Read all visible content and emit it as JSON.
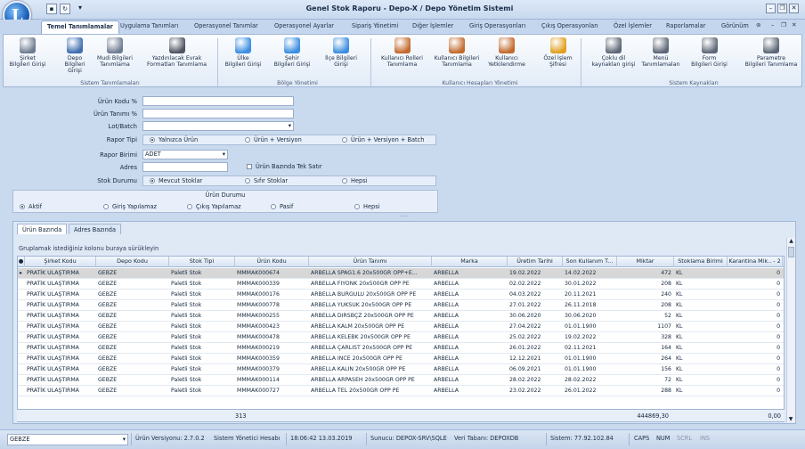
{
  "app": {
    "title": "Genel Stok Raporu  - Depo-X / Depo Yönetim Sistemi"
  },
  "window": {
    "min": "–",
    "restore": "❐",
    "close": "✕"
  },
  "menu_tabs": [
    "Temel Tanımlamalar",
    "Uygulama Tanımları",
    "Operasyonel Tanımlar",
    "Operasyonel Ayarlar",
    "Sipariş Yönetimi",
    "Diğer İşlemler",
    "Giriş Operasyonları",
    "Çıkış Operasyonları",
    "Özel İşlemler",
    "Raporlamalar",
    "Görünüm"
  ],
  "ribbon": {
    "buttons": [
      {
        "label1": "Şirket",
        "label2": "Bilgileri Girişi",
        "icon": "building-icon",
        "color": "#6f7d92"
      },
      {
        "label1": "Depo",
        "label2": "Bilgileri Girişi",
        "icon": "warehouse-icon",
        "color": "#3f6fb0"
      },
      {
        "label1": "Mudi Bilgileri",
        "label2": "Tanımlama",
        "icon": "building-icon",
        "color": "#6f7d92"
      },
      {
        "label1": "Yazdırılacak Evrak",
        "label2": "Formatları Tanımlama",
        "icon": "printer-icon",
        "color": "#4d5360"
      },
      {
        "label1": "Ülke",
        "label2": "Bilgileri Girişi",
        "icon": "globe-icon",
        "color": "#3b8ee0"
      },
      {
        "label1": "Şehir",
        "label2": "Bilgileri Girişi",
        "icon": "globe-icon",
        "color": "#3b8ee0"
      },
      {
        "label1": "İlçe Bilgileri",
        "label2": "Girişi",
        "icon": "globe-icon",
        "color": "#3b8ee0"
      },
      {
        "label1": "Kullanıcı Rolleri",
        "label2": "Tanımlama",
        "icon": "users-icon",
        "color": "#c36a2d"
      },
      {
        "label1": "Kullanıcı Bilgileri",
        "label2": "Tanımlama",
        "icon": "users-icon",
        "color": "#c36a2d"
      },
      {
        "label1": "Kullanıcı",
        "label2": "Yetkilendirme",
        "icon": "users-icon",
        "color": "#c36a2d"
      },
      {
        "label1": "Özel İşlem",
        "label2": "Şifresi",
        "icon": "lock-icon",
        "color": "#e0a020"
      },
      {
        "label1": "Çoklu dil",
        "label2": "kaynakları girişi",
        "icon": "tools-icon",
        "color": "#5e6877"
      },
      {
        "label1": "Menü",
        "label2": "Tanımlamaları",
        "icon": "tools-icon",
        "color": "#5e6877"
      },
      {
        "label1": "Form",
        "label2": "Bilgileri Girişi",
        "icon": "tools-icon",
        "color": "#5e6877"
      },
      {
        "label1": "Parametre",
        "label2": "Bilgileri Tanımlama",
        "icon": "tools-icon",
        "color": "#5e6877"
      }
    ],
    "groups": [
      "Sistem Tanımlamaları",
      "Bölge Yönetimi",
      "Kullanıcı Hesapları Yönetimi",
      "Sistem Kaynakları"
    ]
  },
  "filters": {
    "urun_kodu_label": "Ürün Kodu %",
    "urun_tanimi_label": "Ürün Tanımı %",
    "lot_label": "Lot/Batch",
    "rapor_tipi_label": "Rapor Tipi",
    "rapor_tipi_options": [
      "Yalnızca Ürün",
      "Ürün + Versiyon",
      "Ürün + Versiyon + Batch"
    ],
    "rapor_birimi_label": "Rapor Birimi",
    "rapor_birimi_value": "ADET",
    "tek_satir_label": "Ürün Bazında Tek Satır",
    "adres_label": "Adres",
    "stok_durumu_label": "Stok Durumu",
    "stok_options": [
      "Mevcut Stoklar",
      "Sıfır Stoklar",
      "Hepsi"
    ],
    "urun_durumu_title": "Ürün Durumu",
    "urun_durumu_options": [
      "Aktif",
      "Giriş Yapılamaz",
      "Çıkış Yapılamaz",
      "Pasif",
      "Hepsi"
    ]
  },
  "grid": {
    "tabs": [
      "Ürün Bazında",
      "Adres Bazında"
    ],
    "group_hint": "Gruplamak istediğiniz kolonu buraya sürükleyin",
    "columns": [
      "Şirket Kodu",
      "Depo Kodu",
      "Stok Tipi",
      "Ürün Kodu",
      "Ürün Tanımı",
      "Marka",
      "Üretim Tarihi",
      "Son Kullanım T...",
      "Miktar",
      "Stoklama Birimi",
      "Karantina Mik.. - 2"
    ],
    "rows": [
      [
        "PRATİK ULAŞTIRMA",
        "GEBZE",
        "Paletli Stok",
        "MMMAK000674",
        "ARBELLA SPAG1.6 20x500GR OPP+E...",
        "ARBELLA",
        "19.02.2022",
        "14.02.2022",
        "472",
        "KL",
        "0"
      ],
      [
        "PRATİK ULAŞTIRMA",
        "GEBZE",
        "Paletli Stok",
        "MMMAK000339",
        "ARBELLA FIYONK 20x500GR OPP PE",
        "ARBELLA",
        "02.02.2022",
        "30.01.2022",
        "208",
        "KL",
        "0"
      ],
      [
        "PRATİK ULAŞTIRMA",
        "GEBZE",
        "Paletli Stok",
        "MMMAK000176",
        "ARBELLA BURGULU 20x500GR OPP PE",
        "ARBELLA",
        "04.03.2022",
        "20.11.2021",
        "240",
        "KL",
        "0"
      ],
      [
        "PRATİK ULAŞTIRMA",
        "GEBZE",
        "Paletli Stok",
        "MMMAK000778",
        "ARBELLA YUKSUK 20x500GR OPP PE",
        "ARBELLA",
        "27.01.2022",
        "26.11.2018",
        "208",
        "KL",
        "0"
      ],
      [
        "PRATİK ULAŞTIRMA",
        "GEBZE",
        "Paletli Stok",
        "MMMAK000255",
        "ARBELLA DIRSBÇZ 20x500GR OPP PE",
        "ARBELLA",
        "30.06.2020",
        "30.06.2020",
        "52",
        "KL",
        "0"
      ],
      [
        "PRATİK ULAŞTIRMA",
        "GEBZE",
        "Paletli Stok",
        "MMMAK000423",
        "ARBELLA KALM 20x500GR OPP PE",
        "ARBELLA",
        "27.04.2022",
        "01.01.1900",
        "1107",
        "KL",
        "0"
      ],
      [
        "PRATİK ULAŞTIRMA",
        "GEBZE",
        "Paletli Stok",
        "MMMAK000478",
        "ARBELLA KELEBK 20x500GR OPP PE",
        "ARBELLA",
        "25.02.2022",
        "19.02.2022",
        "328",
        "KL",
        "0"
      ],
      [
        "PRATİK ULAŞTIRMA",
        "GEBZE",
        "Paletli Stok",
        "MMMAK000219",
        "ARBELLA ÇARLIST 20x500GR OPP PE",
        "ARBELLA",
        "26.01.2022",
        "02.11.2021",
        "164",
        "KL",
        "0"
      ],
      [
        "PRATİK ULAŞTIRMA",
        "GEBZE",
        "Paletli Stok",
        "MMMAK000359",
        "ARBELLA INCE 20x500GR OPP PE",
        "ARBELLA",
        "12.12.2021",
        "01.01.1900",
        "264",
        "KL",
        "0"
      ],
      [
        "PRATİK ULAŞTIRMA",
        "GEBZE",
        "Paletli Stok",
        "MMMAK000379",
        "ARBELLA KALIN 20x500GR OPP PE",
        "ARBELLA",
        "06.09.2021",
        "01.01.1900",
        "156",
        "KL",
        "0"
      ],
      [
        "PRATİK ULAŞTIRMA",
        "GEBZE",
        "Paletli Stok",
        "MMMAK000114",
        "ARBELLA ARPASEH 20x500GR OPP PE",
        "ARBELLA",
        "28.02.2022",
        "28.02.2022",
        "72",
        "KL",
        "0"
      ],
      [
        "PRATİK ULAŞTIRMA",
        "GEBZE",
        "Paletli Stok",
        "MMMAK000727",
        "ARBELLA TEL 20x500GR OPP PE",
        "ARBELLA",
        "23.02.2022",
        "26.01.2022",
        "288",
        "KL",
        "0"
      ]
    ],
    "footer": {
      "count": "313",
      "miktar_total": "444869,30",
      "karantina_total": "0,00"
    }
  },
  "status": {
    "location": "GEBZE",
    "version": "Ürün Versiyonu: 2.7.0.2",
    "user": "Sistem Yönetici Hesabı",
    "datetime": "18:06:42 13.03.2019",
    "server": "Sunucu: DEPOX-SRV\\SQLE",
    "database": "Veri Tabanı: DEPOXDB",
    "system": "Sistem: 77.92.102.84",
    "caps": "CAPS",
    "num": "NUM",
    "scrl": "SCRL",
    "ins": "INS"
  }
}
